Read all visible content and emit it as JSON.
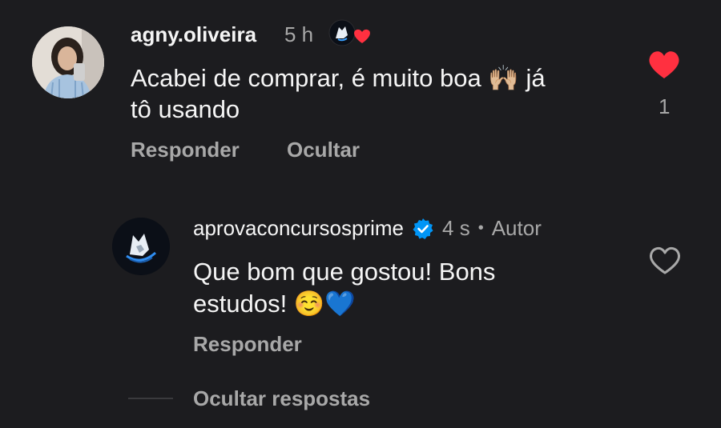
{
  "comment": {
    "username": "agny.oliveira",
    "time": "5 h",
    "text_line1": "Acabei de comprar, é muito boa 🙌🏼 já",
    "text_line2": "tô usando",
    "reply_label": "Responder",
    "hide_label": "Ocultar",
    "like_count": "1",
    "liked": true,
    "like_color": "#ff3040"
  },
  "reply": {
    "username": "aprovaconcursosprime",
    "time": "4 s",
    "separator": "•",
    "author_badge": "Autor",
    "text_line1": "Que bom que gostou! Bons",
    "text_line2": "estudos! ☺️💙",
    "reply_label": "Responder",
    "liked": false,
    "verified_color": "#0095f6"
  },
  "thread": {
    "hide_replies_label": "Ocultar respostas"
  },
  "icons": {
    "liked_heart": "heart-filled-icon",
    "unliked_heart": "heart-outline-icon",
    "verified": "verified-badge-icon",
    "creator_reaction": "creator-heart-reaction-icon"
  }
}
